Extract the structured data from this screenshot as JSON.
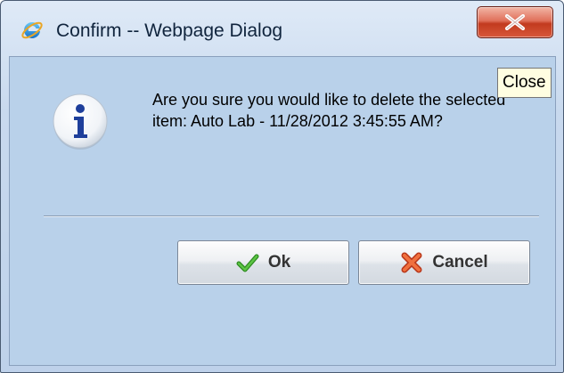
{
  "window": {
    "title": "Confirm -- Webpage Dialog"
  },
  "titlebar": {
    "app_icon": "internet-explorer-icon",
    "close_icon": "close-icon",
    "close_tooltip": "Close"
  },
  "dialog": {
    "icon": "info-icon",
    "message": "Are you sure you would like to delete the selected item: Auto Lab - 11/28/2012 3:45:55 AM?",
    "buttons": {
      "ok_label": "Ok",
      "ok_icon": "checkmark-icon",
      "cancel_label": "Cancel",
      "cancel_icon": "red-x-icon"
    }
  },
  "colors": {
    "close_button": "#d8583a",
    "dialog_background": "#b9d1ea",
    "tooltip_background": "#fffee1",
    "ok_check": "#3aa12a",
    "cancel_x": "#e0502a",
    "info_i": "#1e3f9b"
  }
}
